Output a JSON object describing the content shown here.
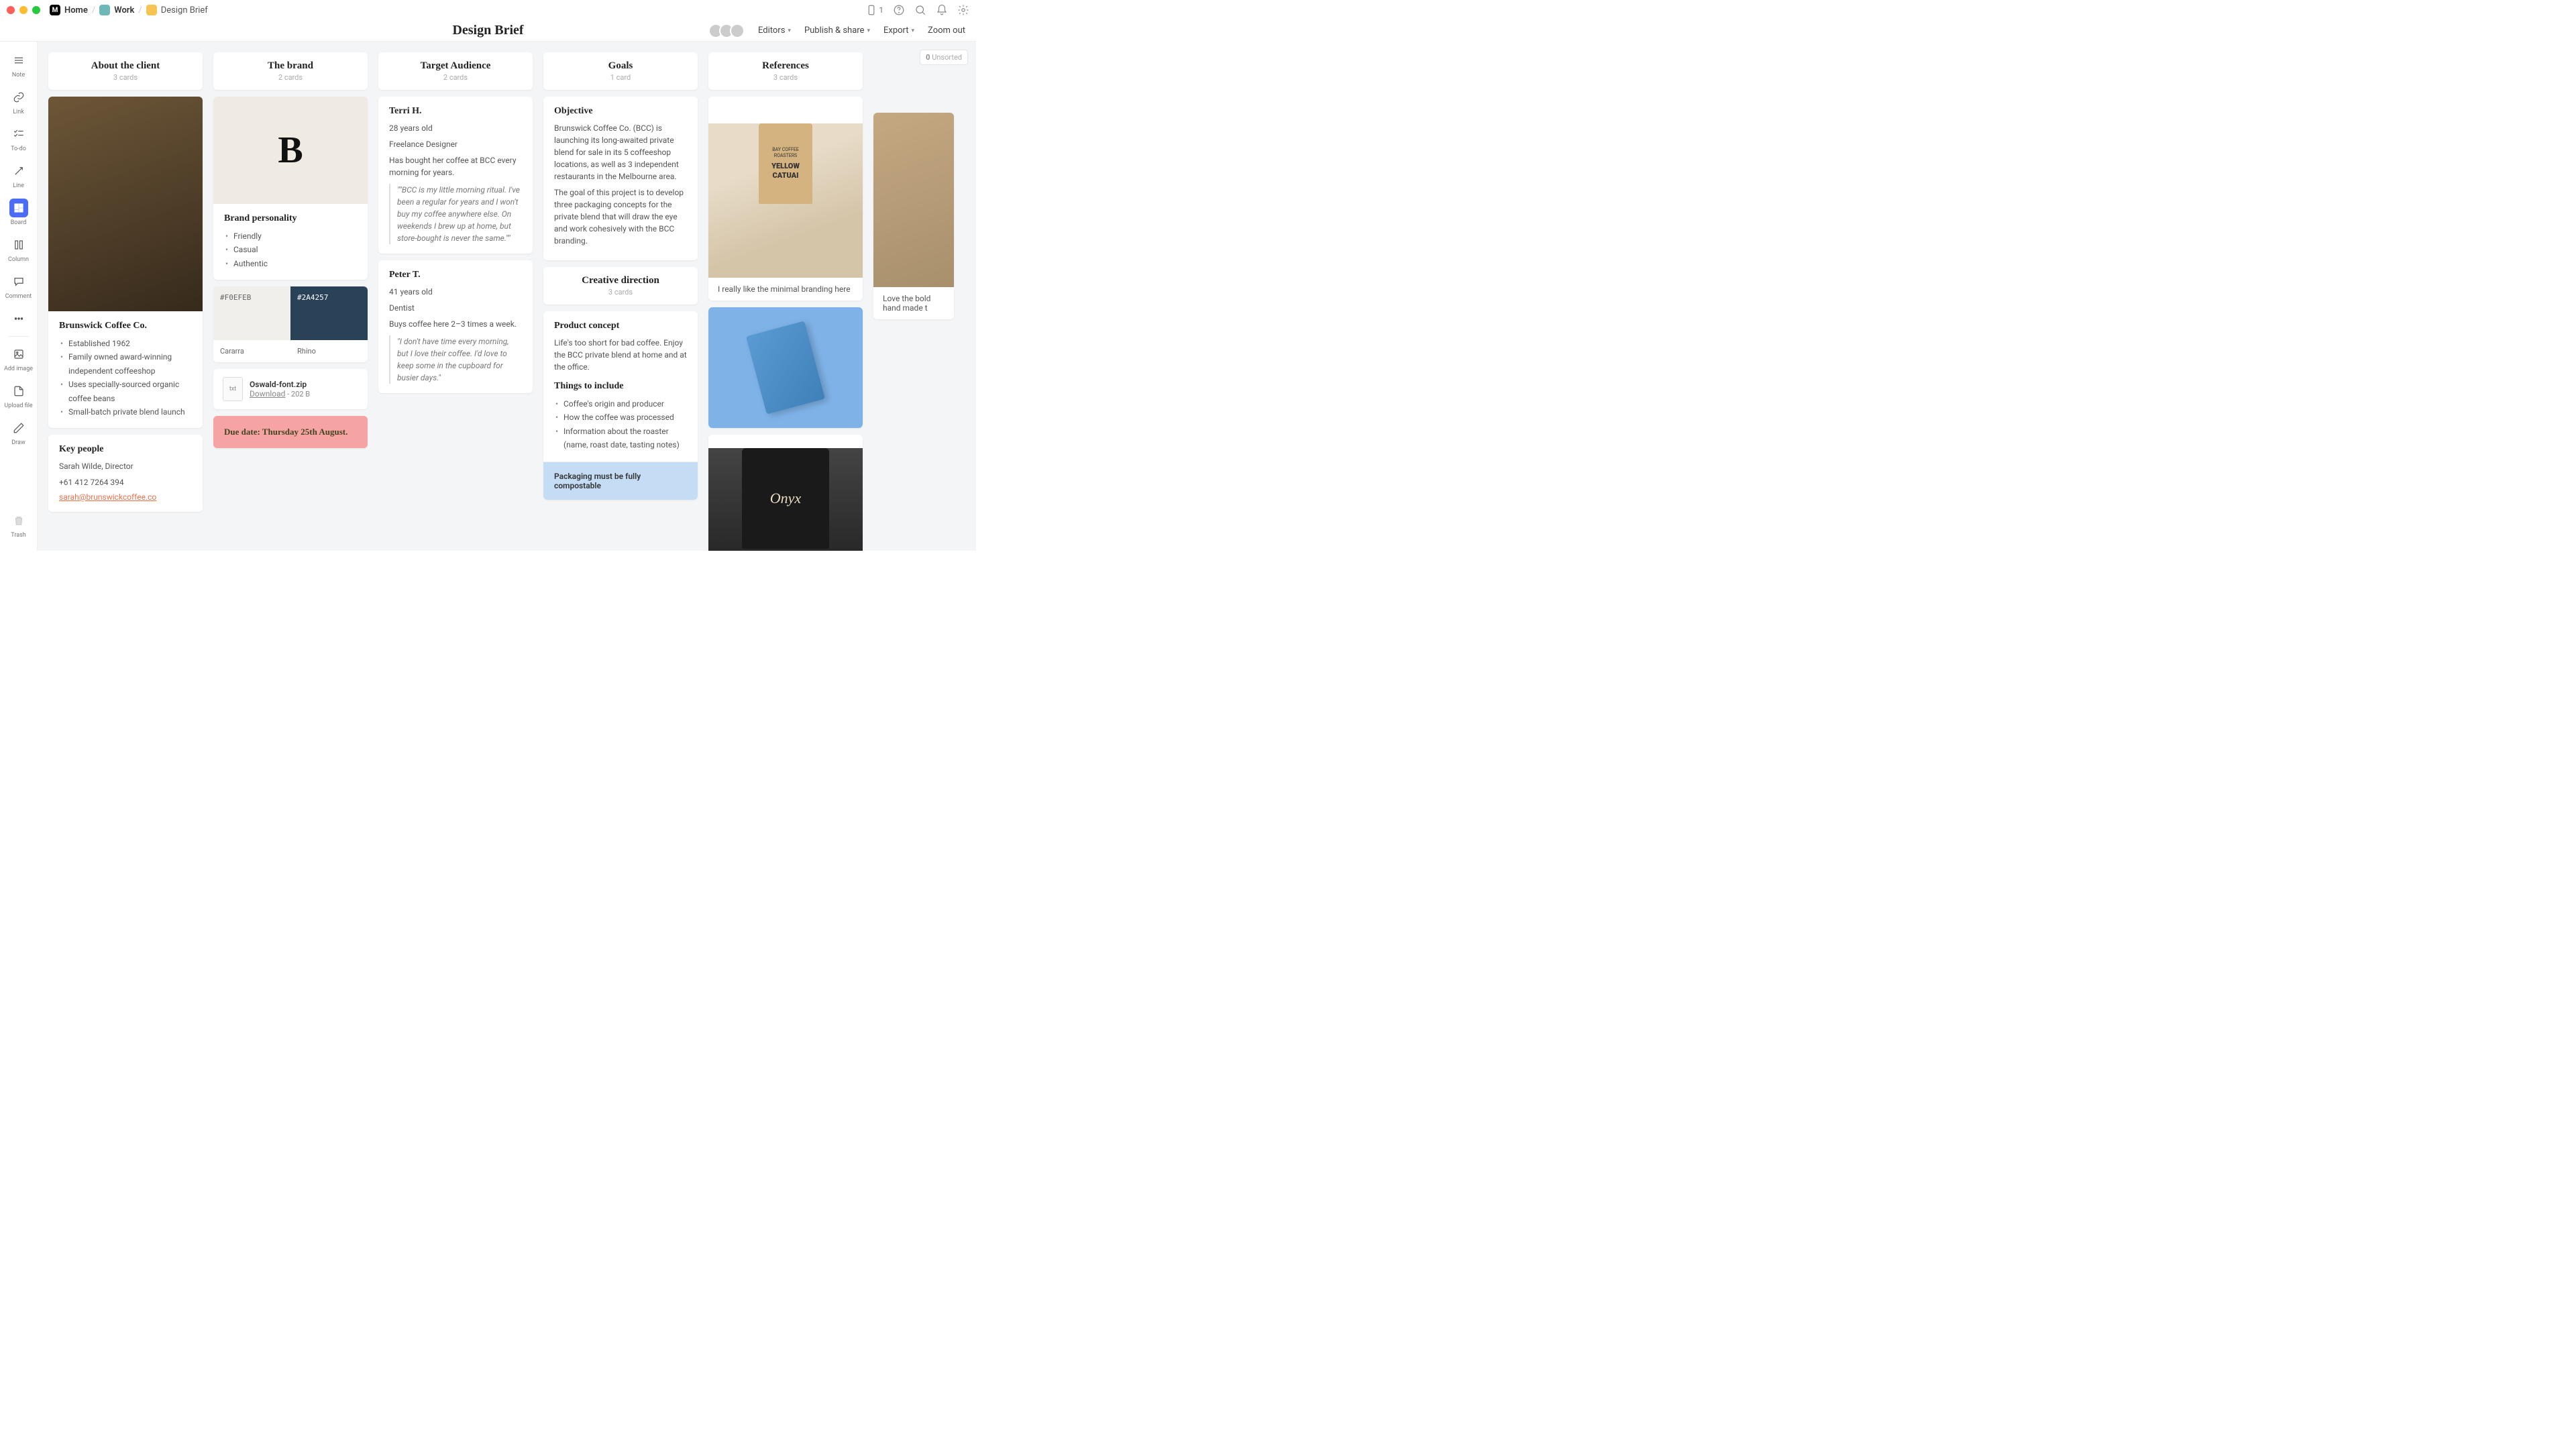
{
  "breadcrumbs": {
    "home": "Home",
    "work": "Work",
    "brief": "Design Brief"
  },
  "topright": {
    "device_count": "1"
  },
  "doc_title": "Design Brief",
  "header": {
    "editors": "Editors",
    "publish": "Publish & share",
    "export": "Export",
    "zoom": "Zoom out"
  },
  "unsorted": {
    "count": "0",
    "label": "Unsorted"
  },
  "tools": {
    "note": "Note",
    "link": "Link",
    "todo": "To-do",
    "line": "Line",
    "board": "Board",
    "column": "Column",
    "comment": "Comment",
    "addimage": "Add image",
    "upload": "Upload file",
    "draw": "Draw",
    "trash": "Trash"
  },
  "columns": {
    "about": {
      "title": "About the client",
      "count": "3 cards",
      "company": "Brunswick Coffee Co.",
      "bullets": [
        "Established 1962",
        "Family owned award-winning independent coffeeshop",
        "Uses specially-sourced organic coffee beans",
        "Small-batch private blend launch"
      ],
      "keypeople_h": "Key people",
      "person": "Sarah Wilde, Director",
      "phone": "+61 412 7264 394",
      "email": "sarah@brunswickcoffee.co"
    },
    "brand": {
      "title": "The brand",
      "count": "2 cards",
      "personality_h": "Brand personality",
      "traits": [
        "Friendly",
        "Casual",
        "Authentic"
      ],
      "swatch1_hex": "#F0EFEB",
      "swatch1_name": "Cararra",
      "swatch1_color": "#F0EFEB",
      "swatch2_hex": "#2A4257",
      "swatch2_name": "Rhino",
      "swatch2_color": "#2A4257",
      "file_name": "Oswald-font.zip",
      "file_ext": "txt",
      "file_dl": "Download",
      "file_size": " - 202 B",
      "due": "Due date: Thursday 25th August."
    },
    "audience": {
      "title": "Target Audience",
      "count": "2 cards",
      "p1_name": "Terri H.",
      "p1_age": "28 years old",
      "p1_job": "Freelance Designer",
      "p1_habit": "Has bought her coffee at BCC every morning for years.",
      "p1_quote": "\"\"BCC is my little morning ritual. I've been a regular for years and I won't buy my coffee anywhere else. On weekends I brew up at home, but store-bought is never the same.\"\"",
      "p2_name": "Peter T.",
      "p2_age": "41 years old",
      "p2_job": "Dentist",
      "p2_habit": "Buys coffee here 2–3 times a week.",
      "p2_quote": "\"I don't have time every morning, but I love their coffee. I'd love to keep some in the cupboard for busier days.\""
    },
    "goals": {
      "title": "Goals",
      "count": "1 card",
      "objective_h": "Objective",
      "obj_p1": "Brunswick Coffee Co. (BCC) is launching its long-awaited private blend for sale in its 5 coffeeshop locations, as well as 3 independent restaurants in the Melbourne area.",
      "obj_p2": "The goal of this project is to develop three packaging concepts for the private blend that will draw the eye and work cohesively with the BCC branding.",
      "creative_h": "Creative direction",
      "creative_count": "3 cards",
      "concept_h": "Product concept",
      "concept_p": "Life's too short for bad coffee. Enjoy the BCC private blend at home and at the office.",
      "things_h": "Things to include",
      "things": [
        "Coffee's origin and producer",
        "How the coffee was processed",
        "Information about the roaster (name, roast date, tasting notes)"
      ],
      "callout": "Packaging must be fully compostable"
    },
    "refs": {
      "title": "References",
      "count": "3 cards",
      "cap1": "I really like the minimal branding here",
      "cap2": "Love the bold hand made t",
      "bag_brand": "BAY COFFEE ROASTERS",
      "bag_name": "YELLOW CATUAI"
    }
  }
}
